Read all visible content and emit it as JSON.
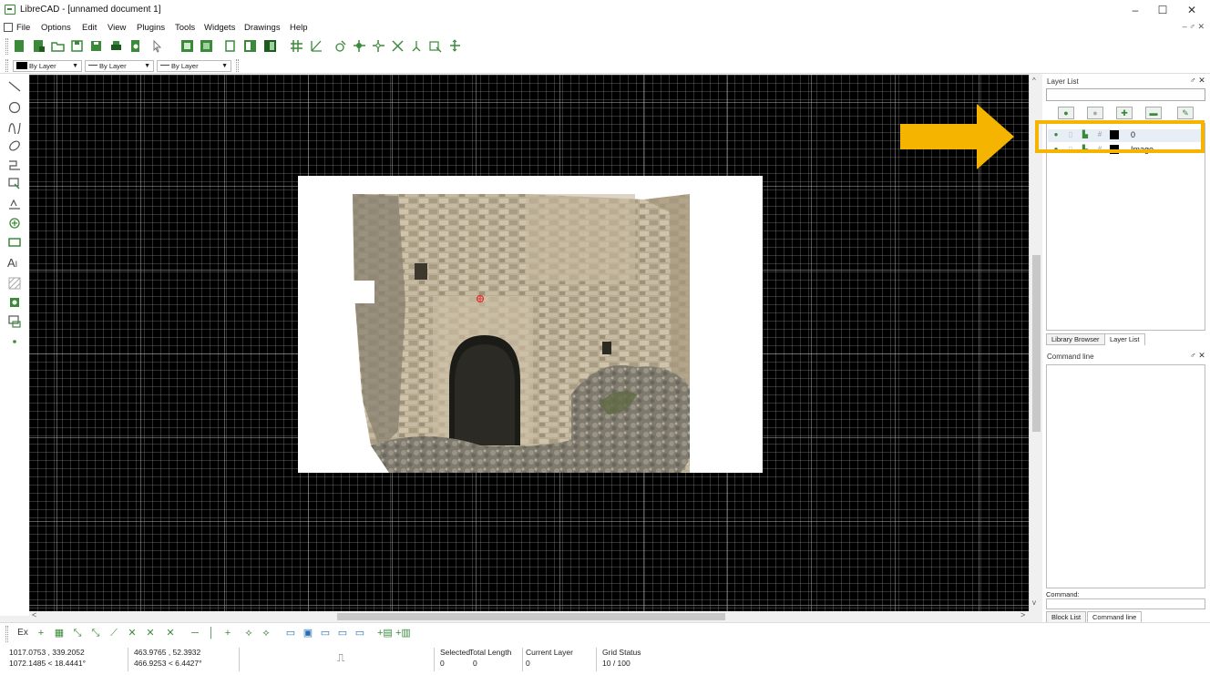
{
  "window": {
    "title": "LibreCAD - [unnamed document 1]",
    "minimize": "–",
    "maximize": "☐",
    "close": "✕"
  },
  "menu": [
    "File",
    "Options",
    "Edit",
    "View",
    "Plugins",
    "Tools",
    "Widgets",
    "Drawings",
    "Help"
  ],
  "mdi_controls": "– ♂ ✕",
  "pen_toolbar": {
    "color": "By Layer",
    "width": "By Layer",
    "linetype": "By Layer"
  },
  "layer_list": {
    "title": "Layer List",
    "filter_placeholder": "",
    "layers": [
      {
        "name": "0",
        "color": "#000000",
        "highlighted": true
      },
      {
        "name": "Image",
        "color": "#000000",
        "highlighted": false
      }
    ]
  },
  "dock_tabs_top": [
    "Library Browser",
    "Layer List"
  ],
  "command_line": {
    "title": "Command line",
    "prompt_label": "Command:"
  },
  "dock_tabs_bottom": [
    "Block List",
    "Command line"
  ],
  "snap_toolbar": {
    "first_label": "Ex"
  },
  "status": {
    "abs_coord": "1017.0753 , 339.2052",
    "abs_polar": "1072.1485 < 18.4441°",
    "rel_coord": "463.9765 , 52.3932",
    "rel_polar": "466.9253 < 6.4427°",
    "selected_label": "Selected",
    "selected_value": "0",
    "total_length_label": "Total Length",
    "total_length_value": "0",
    "current_layer_label": "Current Layer",
    "current_layer_value": "0",
    "grid_status_label": "Grid Status",
    "grid_status_value": "10 / 100"
  },
  "colors": {
    "canvas": "#000000",
    "highlight": "#f5b400",
    "icon_green": "#3a8a3a"
  }
}
